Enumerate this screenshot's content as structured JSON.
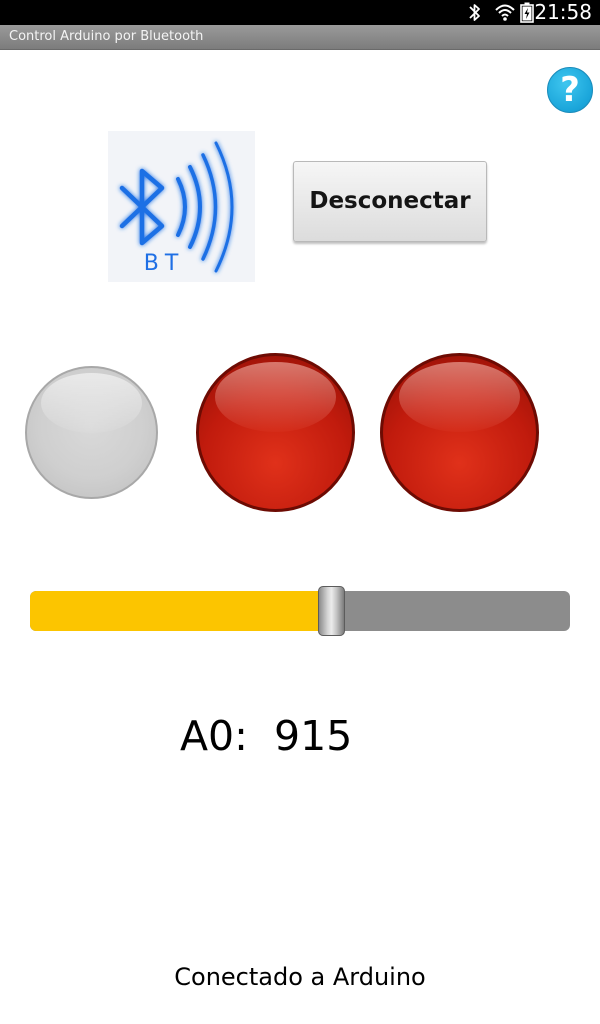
{
  "status_bar": {
    "time": "21:58",
    "icons": [
      "bluetooth-icon",
      "wifi-icon",
      "battery-charging-icon"
    ]
  },
  "app": {
    "title": "Control Arduino por Bluetooth"
  },
  "help_button": {
    "glyph": "?",
    "icon": "help-icon",
    "color": "#1aa5da"
  },
  "bluetooth_logo": {
    "icon": "bluetooth-signal-logo",
    "label": "BT",
    "color": "#1f6fe5"
  },
  "disconnect_button": {
    "label": "Desconectar"
  },
  "leds": [
    {
      "name": "led-1",
      "state": "off",
      "color": "#cfcfcf"
    },
    {
      "name": "led-2",
      "state": "on",
      "color": "#c11b0d"
    },
    {
      "name": "led-3",
      "state": "on",
      "color": "#c11b0d"
    }
  ],
  "slider": {
    "value_fraction": 0.56,
    "fill_color": "#fcc500",
    "track_color": "#8c8c8c"
  },
  "analog_readout": {
    "label": "A0:",
    "value": "915"
  },
  "connection_status": "Conectado a Arduino"
}
